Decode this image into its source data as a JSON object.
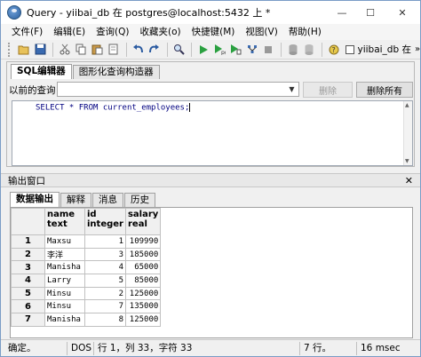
{
  "window": {
    "title": "Query - yiibai_db 在  postgres@localhost:5432 上 *",
    "minimize": "—",
    "maximize": "☐",
    "close": "✕"
  },
  "menu": [
    "文件(F)",
    "编辑(E)",
    "查询(Q)",
    "收藏夹(o)",
    "快捷键(M)",
    "视图(V)",
    "帮助(H)"
  ],
  "toolbar": {
    "checkbox_label": "yiibai_db 在"
  },
  "editor_tabs": [
    {
      "label": "SQL编辑器",
      "active": true
    },
    {
      "label": "图形化查询构造器",
      "active": false
    }
  ],
  "previous_queries": {
    "label": "以前的查询",
    "value": "",
    "delete_label": "删除",
    "delete_all_label": "删除所有"
  },
  "sql": {
    "text": "SELECT * FROM current_employees;"
  },
  "output": {
    "title": "输出窗口",
    "close": "✕",
    "tabs": [
      {
        "label": "数据输出",
        "active": true
      },
      {
        "label": "解释",
        "active": false
      },
      {
        "label": "消息",
        "active": false
      },
      {
        "label": "历史",
        "active": false
      }
    ],
    "columns": [
      {
        "name": "name",
        "type": "text"
      },
      {
        "name": "id",
        "type": "integer"
      },
      {
        "name": "salary",
        "type": "real"
      }
    ],
    "rows": [
      {
        "num": "1",
        "name": "Maxsu",
        "id": "1",
        "salary": "109990"
      },
      {
        "num": "2",
        "name": "李洋",
        "id": "3",
        "salary": "185000"
      },
      {
        "num": "3",
        "name": "Manisha",
        "id": "4",
        "salary": "65000"
      },
      {
        "num": "4",
        "name": "Larry",
        "id": "5",
        "salary": "85000"
      },
      {
        "num": "5",
        "name": "Minsu",
        "id": "2",
        "salary": "125000"
      },
      {
        "num": "6",
        "name": "Minsu",
        "id": "7",
        "salary": "135000"
      },
      {
        "num": "7",
        "name": "Manisha",
        "id": "8",
        "salary": "125000"
      }
    ]
  },
  "status": {
    "state": "确定。",
    "encoding": "DOS",
    "position": "行 1，列 33，字符 33",
    "rows": "7 行。",
    "time": "16 msec"
  }
}
